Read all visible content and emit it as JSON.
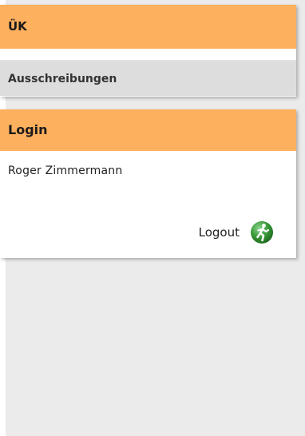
{
  "uk_panel": {
    "title": "ÜK",
    "menu_item": "Ausschreibungen"
  },
  "login_panel": {
    "title": "Login",
    "user_name": "Roger Zimmermann",
    "logout_label": "Logout",
    "logout_icon": "exit-runner-icon"
  },
  "colors": {
    "header_accent": "#fdb05e",
    "menu_item_bg": "#dddddd",
    "backdrop": "#ebebeb",
    "logout_icon": "#2e8b2e"
  }
}
